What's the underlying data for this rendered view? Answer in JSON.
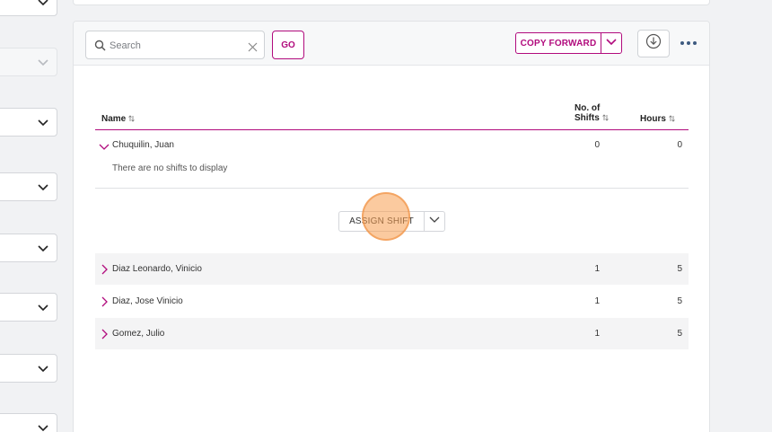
{
  "toolbar": {
    "search_placeholder": "Search",
    "go_label": "GO",
    "copy_forward_label": "COPY FORWARD"
  },
  "table": {
    "columns": {
      "name": "Name",
      "shifts_line1": "No. of",
      "shifts_line2": "Shifts",
      "hours": "Hours"
    },
    "expanded_employee": {
      "name": "Chuquilin, Juan",
      "shifts": "0",
      "hours": "0",
      "empty_message": "There are no shifts to display",
      "assign_label": "ASSIGN SHIFT"
    },
    "rows": [
      {
        "name": "Diaz Leonardo, Vinicio",
        "shifts": "1",
        "hours": "5"
      },
      {
        "name": "Diaz, Jose Vinicio",
        "shifts": "1",
        "hours": "5"
      },
      {
        "name": "Gomez, Julio",
        "shifts": "1",
        "hours": "5"
      }
    ]
  },
  "colors": {
    "accent": "#b10b7d",
    "click_indicator": "#f79f50",
    "more_dots": "#3d5a80"
  },
  "icons": {
    "search": "search-icon",
    "clear": "close-icon",
    "dropdown": "chevron-down-icon",
    "download": "download-circle-icon",
    "more": "more-horizontal-icon",
    "expand": "chevron-right-icon",
    "collapse": "chevron-down-icon",
    "sort": "sort-icon"
  }
}
